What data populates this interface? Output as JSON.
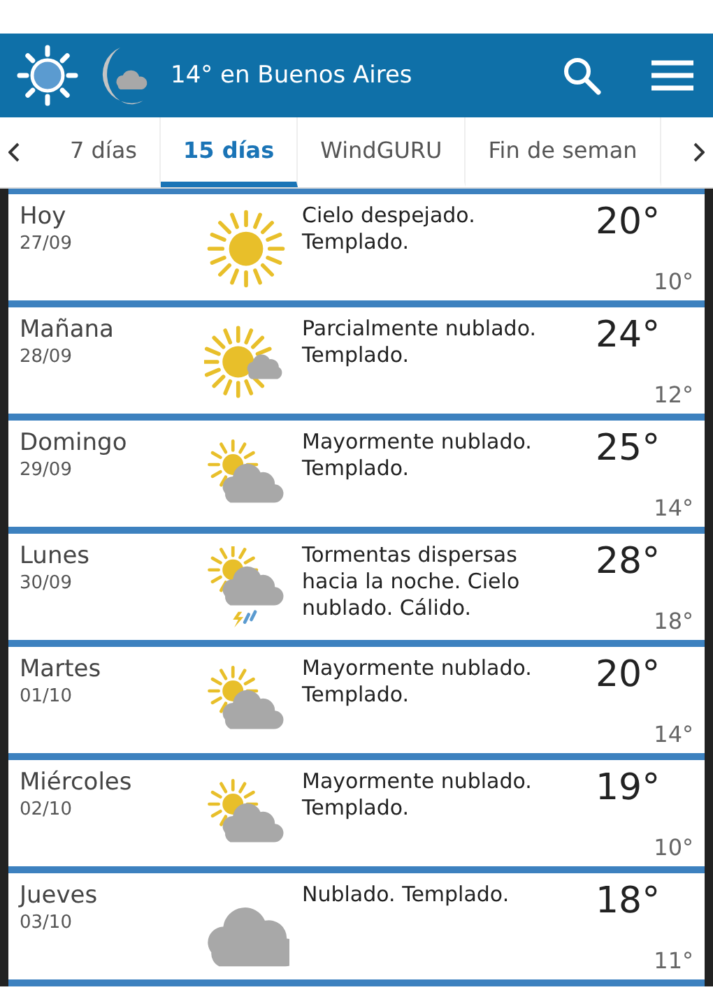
{
  "header": {
    "title": "14° en Buenos Aires"
  },
  "tabs": [
    {
      "label": "7 días",
      "selected": false
    },
    {
      "label": "15 días",
      "selected": true
    },
    {
      "label": "WindGURU",
      "selected": false
    },
    {
      "label": "Fin de seman",
      "selected": false
    }
  ],
  "days": [
    {
      "day": "Hoy",
      "date": "27/09",
      "kind": "sun",
      "summary": "Cielo despejado. Templado.",
      "high": "20°",
      "low": "10°"
    },
    {
      "day": "Mañana",
      "date": "28/09",
      "kind": "sun_cloud",
      "summary": "Parcialmente nublado. Templado.",
      "high": "24°",
      "low": "12°"
    },
    {
      "day": "Domingo",
      "date": "29/09",
      "kind": "mostly_cloudy",
      "summary": "Mayormente nublado. Templado.",
      "high": "25°",
      "low": "14°"
    },
    {
      "day": "Lunes",
      "date": "30/09",
      "kind": "storm",
      "summary": "Tormentas dispersas hacia la noche. Cielo nublado. Cálido.",
      "high": "28°",
      "low": "18°"
    },
    {
      "day": "Martes",
      "date": "01/10",
      "kind": "mostly_cloudy",
      "summary": "Mayormente nublado. Templado.",
      "high": "20°",
      "low": "14°"
    },
    {
      "day": "Miércoles",
      "date": "02/10",
      "kind": "mostly_cloudy",
      "summary": "Mayormente nublado. Templado.",
      "high": "19°",
      "low": "10°"
    },
    {
      "day": "Jueves",
      "date": "03/10",
      "kind": "cloud",
      "summary": "Nublado. Templado.",
      "high": "18°",
      "low": "11°"
    }
  ]
}
